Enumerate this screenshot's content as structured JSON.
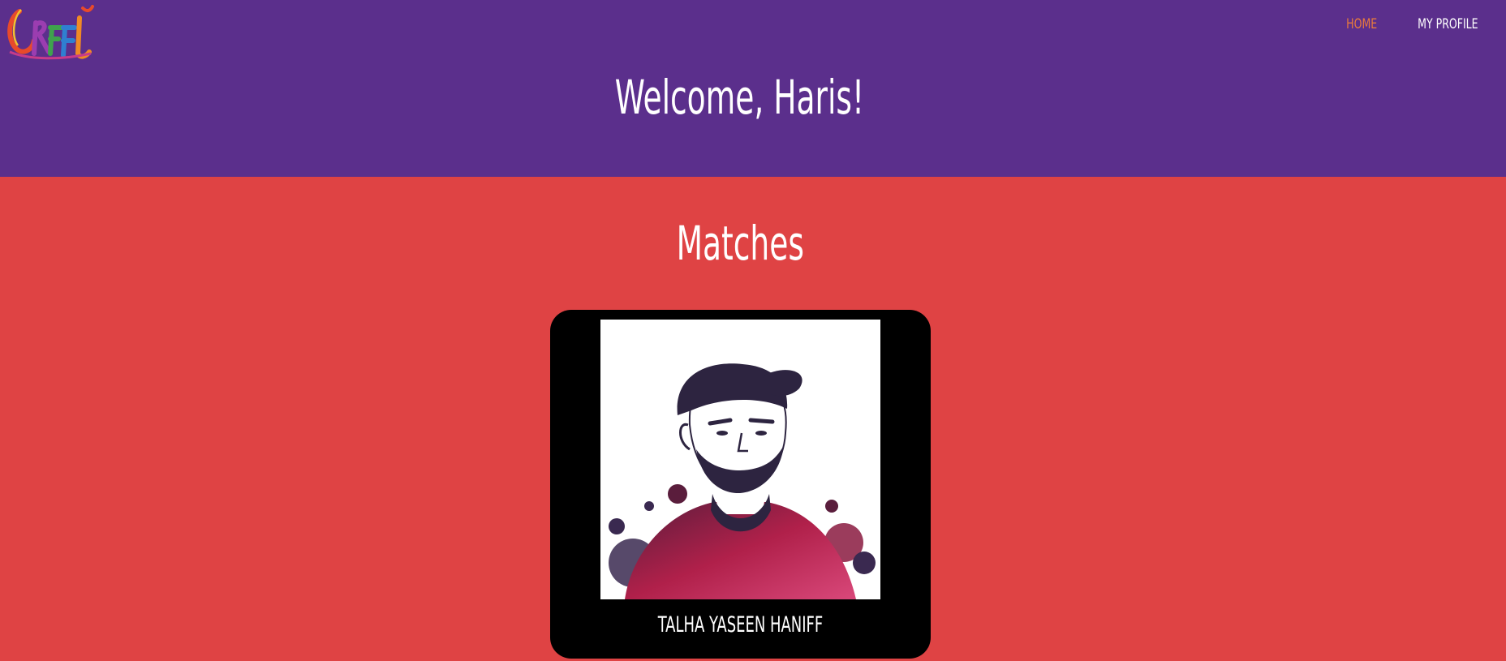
{
  "header": {
    "logo_icon": "graffiti-logo-icon",
    "nav": [
      {
        "label": "HOME",
        "active": true
      },
      {
        "label": "MY PROFILE",
        "active": false
      }
    ],
    "welcome": "Welcome, Haris!"
  },
  "main": {
    "title": "Matches",
    "matches": [
      {
        "name": "TALHA YASEEN HANIFF",
        "photo_icon": "profile-photo"
      }
    ]
  },
  "colors": {
    "header_bg": "#5b2f8c",
    "main_bg": "#df4344",
    "nav_active": "#e97a3c",
    "card_bg": "#000000"
  }
}
